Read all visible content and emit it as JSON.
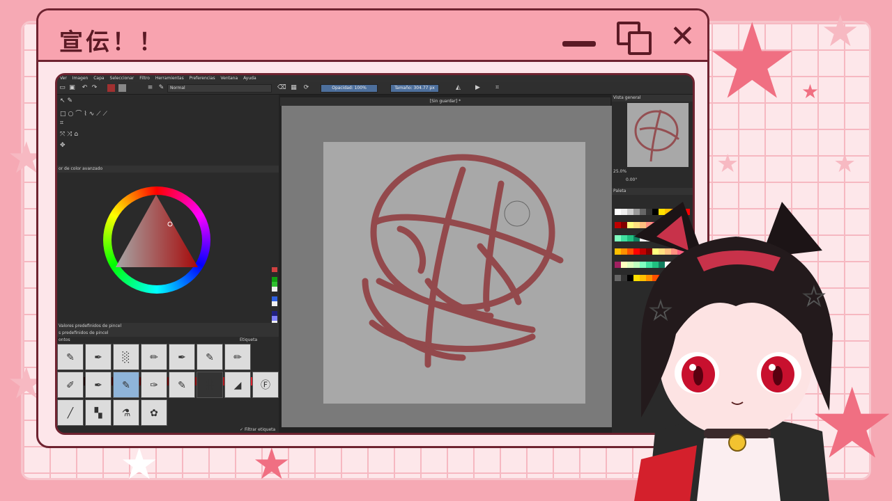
{
  "window": {
    "title": "宣伝！！"
  },
  "app": {
    "menu": [
      "Ver",
      "Imagen",
      "Capa",
      "Seleccionar",
      "Filtro",
      "Herramientas",
      "Preferencias",
      "Ventana",
      "Ayuda"
    ],
    "blend_mode": "Normal",
    "opacity_label": "Opacidad: 100%",
    "size_label": "Tamaño: 304.77 px",
    "document_title": "[Sin guardar] *",
    "color_panel_title": "or de color avanzado",
    "presets_tab": "Valores predefinidos de pincel",
    "presets_title": "s predefinidos de pincel",
    "presets_filter_left": "ontos",
    "presets_tag_label": "Etiqueta",
    "filter_tag": "Filtrar etiqueta",
    "overview_title": "Vista general",
    "zoom": "25.0%",
    "rotation": "0.00°",
    "palette_title": "Paleta"
  },
  "colors": {
    "accent": "#f8a3af",
    "outline": "#6e2330",
    "stroke": "#8c2a2e"
  }
}
